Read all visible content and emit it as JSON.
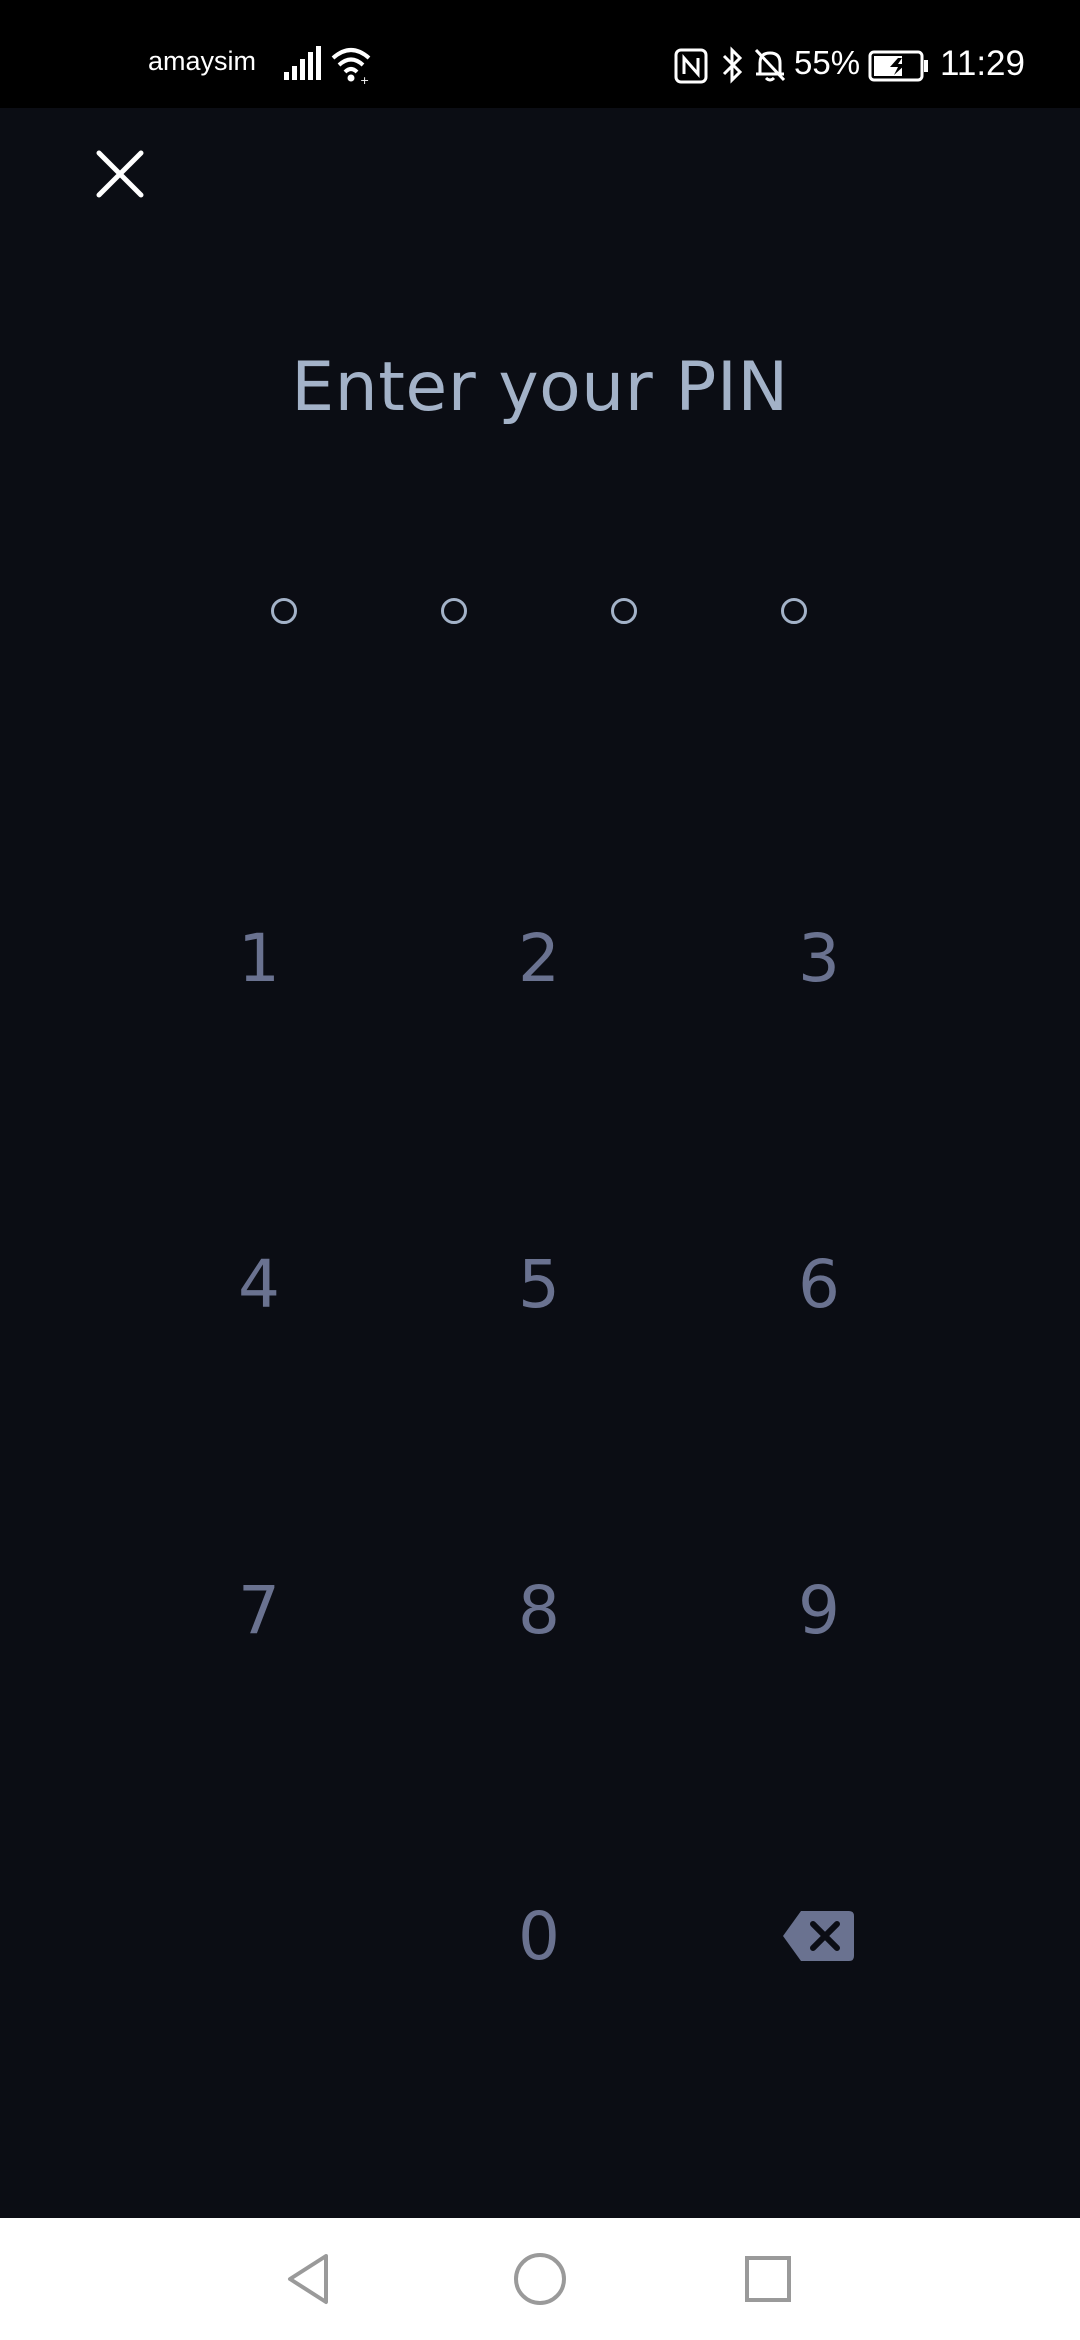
{
  "status_bar": {
    "carrier": "amaysim",
    "battery_percent": "55%",
    "time": "11:29",
    "icons": [
      "signal-icon",
      "wifi-icon",
      "nfc-icon",
      "bluetooth-icon",
      "mute-icon",
      "battery-charging-icon"
    ]
  },
  "header": {
    "close_icon": "close-icon",
    "title": "Enter your PIN"
  },
  "pin": {
    "length": 4,
    "filled": 0
  },
  "keypad": {
    "keys": [
      "1",
      "2",
      "3",
      "4",
      "5",
      "6",
      "7",
      "8",
      "9",
      "0"
    ],
    "backspace_icon": "backspace-icon"
  },
  "colors": {
    "background": "#0b0d14",
    "title": "#a3b2c8",
    "key": "#6a7290",
    "status_bar": "#000000"
  },
  "nav_bar": {
    "icons": [
      "back-icon",
      "home-icon",
      "recents-icon"
    ]
  }
}
